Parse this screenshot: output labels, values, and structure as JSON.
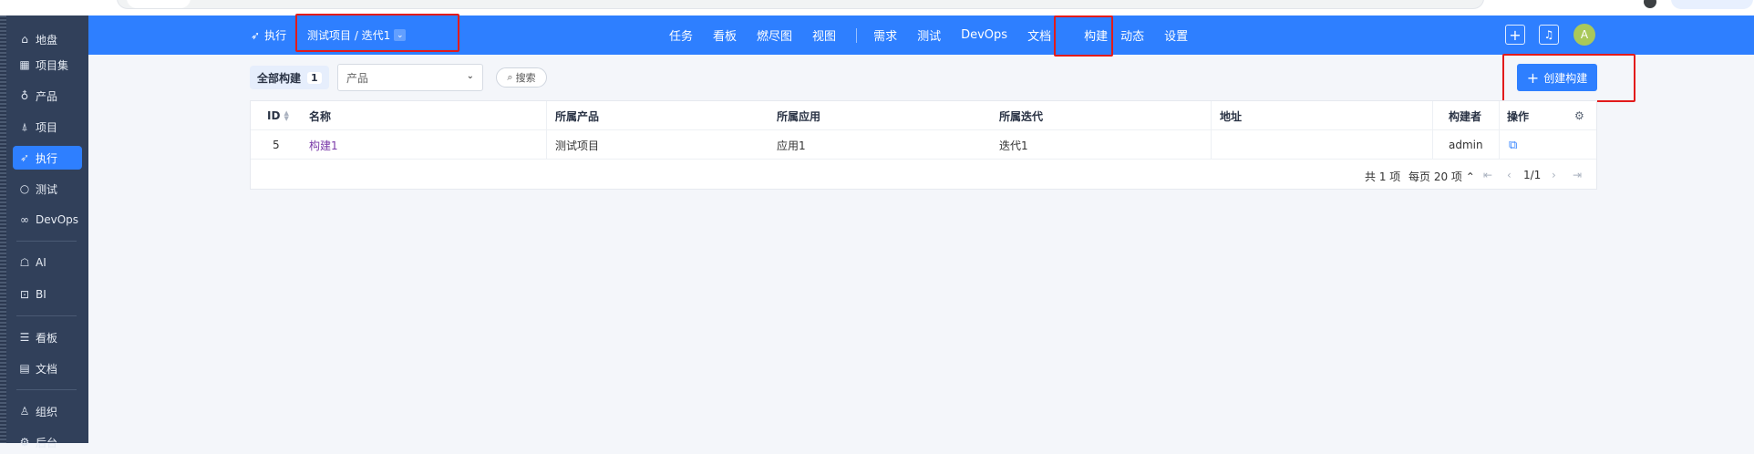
{
  "sidebar": {
    "items": [
      {
        "label": "地盘",
        "icon": "home-icon"
      },
      {
        "label": "项目集",
        "icon": "grid-icon"
      },
      {
        "label": "产品",
        "icon": "bulb-icon"
      },
      {
        "label": "项目",
        "icon": "rocket-icon"
      },
      {
        "label": "执行",
        "icon": "send-icon"
      },
      {
        "label": "测试",
        "icon": "magnifier-icon"
      },
      {
        "label": "DevOps",
        "icon": "infinity-icon"
      },
      {
        "label": "AI",
        "icon": "robot-icon"
      },
      {
        "label": "BI",
        "icon": "presentation-icon"
      },
      {
        "label": "看板",
        "icon": "kanban-icon"
      },
      {
        "label": "文档",
        "icon": "document-icon"
      },
      {
        "label": "组织",
        "icon": "people-icon"
      },
      {
        "label": "后台",
        "icon": "gear-icon"
      }
    ],
    "active": "执行"
  },
  "header": {
    "section": "执行",
    "project_crumb": "测试项目 / 迭代1",
    "nav": [
      "任务",
      "看板",
      "燃尽图",
      "视图",
      "需求",
      "测试",
      "DevOps",
      "文档",
      "构建",
      "动态",
      "设置"
    ],
    "active_nav": "构建",
    "add_icon": "plus-icon",
    "bell_icon": "bell-icon",
    "avatar_initial": "A"
  },
  "toolbar": {
    "tab_label": "全部构建",
    "tab_count": "1",
    "product_placeholder": "产品",
    "search_label": "搜索",
    "create_label": "创建构建"
  },
  "table": {
    "columns": [
      "ID",
      "名称",
      "所属产品",
      "所属应用",
      "所属迭代",
      "地址",
      "构建者",
      "操作"
    ],
    "rows": [
      {
        "id": "5",
        "name": "构建1",
        "product": "测试项目",
        "app": "应用1",
        "iteration": "迭代1",
        "address": "",
        "builder": "admin",
        "action_icon": "deploy-icon"
      }
    ]
  },
  "pager": {
    "total": "共 1 项",
    "per_page": "每页 20 项",
    "page": "1/1"
  },
  "colors": {
    "brand": "#2e7fff",
    "sidebar": "#31405a",
    "highlight_box": "#e21b1b"
  }
}
